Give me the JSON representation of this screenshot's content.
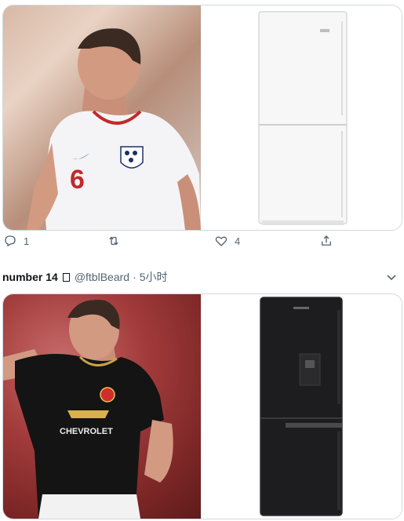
{
  "tweet_actions": {
    "reply_count": "1",
    "like_count": "4"
  },
  "next_tweet": {
    "display_name": "number 14",
    "handle": "@ftblBeard",
    "separator": "·",
    "time": "5小时"
  },
  "jersey": {
    "number": "6",
    "sponsor": "CHEVROLET"
  },
  "colors": {
    "accent_gray": "#536471",
    "border": "#cfd9de"
  }
}
